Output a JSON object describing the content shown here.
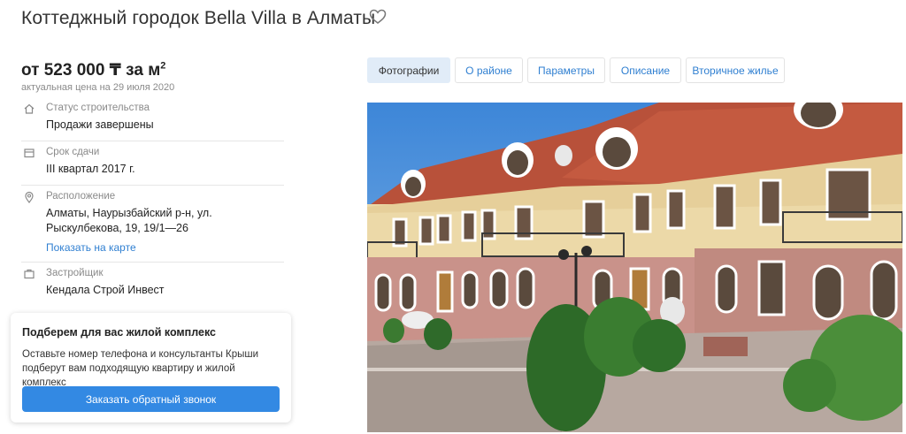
{
  "header": {
    "title": "Коттеджный городок Bella Villa в Алматы"
  },
  "price": {
    "main": "от 523 000 ₸ за м",
    "unit_sup": "2",
    "note": "актуальная цена на 29 июля 2020"
  },
  "info": {
    "status": {
      "label": "Статус строительства",
      "value": "Продажи завершены",
      "icon": "home-icon"
    },
    "deadline": {
      "label": "Срок сдачи",
      "value": "III квартал 2017 г.",
      "icon": "calendar-icon"
    },
    "location": {
      "label": "Расположение",
      "value": "Алматы, Наурызбайский р-н, ул. Рыскулбекова, 19, 19/1—26",
      "link": "Показать на карте",
      "icon": "map-pin-icon"
    },
    "developer": {
      "label": "Застройщик",
      "value": "Кендала Строй Инвест",
      "icon": "building-icon"
    }
  },
  "callback": {
    "title": "Подберем для вас жилой комплекс",
    "text": "Оставьте номер телефона и консультанты Крыши подберут вам подходящую квартиру и жилой комплекс",
    "button": "Заказать обратный звонок"
  },
  "tabs": [
    {
      "label": "Фотографии",
      "active": true
    },
    {
      "label": "О районе",
      "active": false
    },
    {
      "label": "Параметры",
      "active": false
    },
    {
      "label": "Описание",
      "active": false
    },
    {
      "label": "Вторичное жилье",
      "active": false
    }
  ],
  "colors": {
    "accent": "#3389e3",
    "link": "#2f7fd1",
    "active_tab": "#e1ecf8"
  }
}
